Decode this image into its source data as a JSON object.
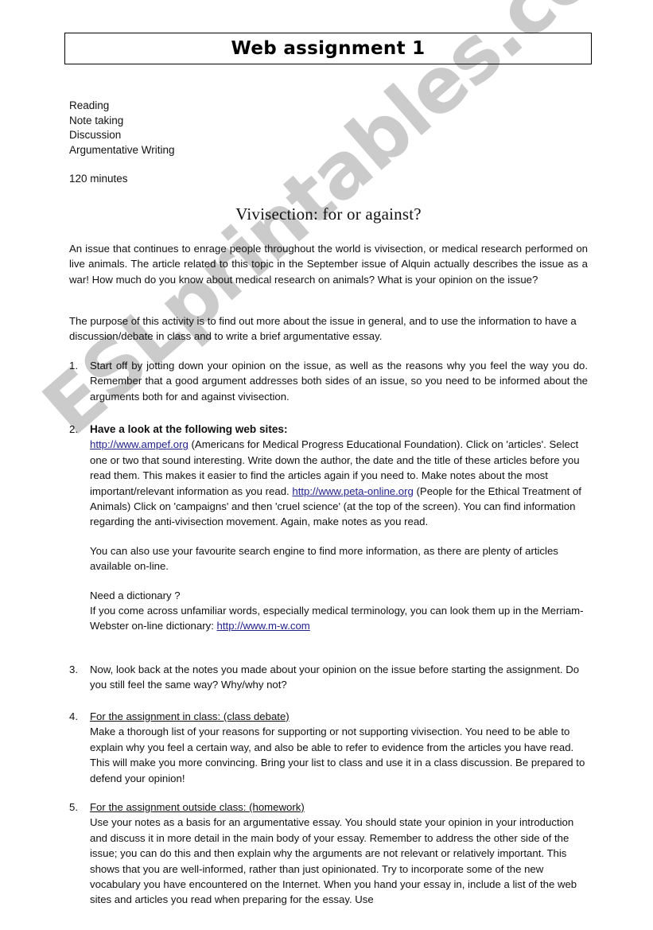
{
  "document": {
    "title": "Web assignment 1",
    "skills": [
      "Reading",
      "Note taking",
      "Discussion",
      "Argumentative Writing"
    ],
    "duration": "120 minutes",
    "section_heading": "Vivisection: for or against?",
    "intro_paragraph": "An issue that continues to enrage people throughout the world is vivisection, or medical research performed on live animals. The article related to this topic in the September issue of Alquin actually describes the issue as a war! How much do you know about medical research on animals? What is your opinion on the issue?",
    "purpose_paragraph": "The purpose of this activity is to find out more about the issue in general, and to use the information to have a discussion/debate in class and to write a brief argumentative essay.",
    "items": [
      {
        "number": "1.",
        "text": "Start off by jotting down your opinion on the issue, as well as the reasons why you feel the way you do. Remember that a good argument addresses both sides of an issue, so you need to be informed about the arguments both for and against vivisection."
      },
      {
        "number": "2.",
        "heading": "Have a look at the following web sites:",
        "link1": "http://www.ampef.org",
        "text_after_link1": " (Americans for Medical Progress Educational Foundation). Click on 'articles'. Select one or two that sound interesting. Write down the author, the date and the title of these articles before you read them. This makes it easier to find the articles again if you need to. Make notes about the most important/relevant information as you read. ",
        "link2": "http://www.peta-online.org",
        "text_after_link2": " (People for the Ethical Treatment of Animals) Click on 'campaigns' and then 'cruel science' (at the top of the screen). You can find information regarding the anti-vivisection movement. Again, make notes as you read.",
        "search_engine_paragraph": "You can also use your favourite search engine to find more information, as there are plenty of articles available on-line.",
        "dictionary_heading": "Need a dictionary ?",
        "dictionary_text_before_link": "If you come across unfamiliar words, especially medical terminology, you can look them up in the Merriam-Webster on-line dictionary: ",
        "link3": "http://www.m-w.com"
      },
      {
        "number": "3.",
        "text": "Now, look back at the notes you made about your opinion on the issue before starting the assignment. Do you still feel the same way? Why/why not?"
      },
      {
        "number": "4.",
        "heading": "For the assignment in class: (class debate)",
        "text": "Make a thorough list of your reasons for supporting or not supporting vivisection. You need to be able to explain why you feel a certain way, and also be able to refer to evidence from the articles you have read. This will make you more convincing. Bring your list to class and use it in a class discussion. Be prepared to defend your opinion!"
      },
      {
        "number": "5.",
        "heading": "For the assignment outside class: (homework)",
        "text": "Use your notes as a basis for an argumentative essay. You should state your opinion in your introduction and discuss it in more detail in the main body of your essay. Remember to address the other side of the issue; you can do this and then explain why the arguments are not relevant or relatively important. This shows that you are well-informed, rather than just opinionated. Try to incorporate some of the new vocabulary you have encountered on the Internet. When you hand your essay in, include a list of the web sites and articles you read when preparing for the essay. Use"
      }
    ],
    "watermark": "ESLprintables.com",
    "colors": {
      "link": "#22228c",
      "watermark": "#c9c9c9",
      "text": "#111111",
      "border": "#000000"
    }
  }
}
